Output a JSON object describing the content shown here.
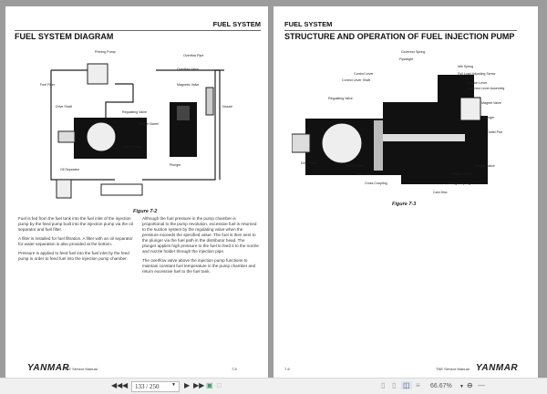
{
  "left_page": {
    "header": "FUEL SYSTEM",
    "title": "FUEL SYSTEM DIAGRAM",
    "labels": [
      "Priming Pump",
      "Overflow Pipe",
      "Overflow Valve",
      "Fuel Filter",
      "Magnetic Valve",
      "Drive Shaft",
      "Regulating Valve",
      "Nozzle",
      "Plunger Barrel",
      "Feed Pump",
      "Plunger",
      "Oil Separator"
    ],
    "figure": "Figure 7-2",
    "col1": [
      "Fuel is fed from the fuel tank into the fuel inlet of the injection pump by the feed pump built into the injection pump via the oil separator and fuel filter.",
      "A filter is installed for fuel filtration. A filter with an oil separator for water separation is also provided at the bottom.",
      "Pressure is applied to feed fuel into the fuel inlet by the feed pump in order to feed fuel into the injection pump chamber."
    ],
    "col2": [
      "Although the fuel pressure in the pump chamber is proportional to the pump revolution, excessive fuel is returned to the suction system by the regulating valve when the pressure exceeds the specified value. The fuel is then sent to the plunger via the fuel path in the distributor head. The plunger applies high pressure to the fuel to feed it to the nozzle and nozzle holder through the injection pipe.",
      "The overflow valve above the injection pump functions to maintain constant fuel temperature in the pump chamber and return excessive fuel to the fuel tank."
    ],
    "logo": "YANMAR",
    "manual": "TNE Service Manual",
    "page_no": "7-5"
  },
  "right_page": {
    "header": "FUEL SYSTEM",
    "title": "STRUCTURE AND OPERATION OF FUEL INJECTION PUMP",
    "labels": [
      "Governor Spring",
      "Flyweight",
      "Idle Spring",
      "Control Lever",
      "Full Load Adjusting Screw",
      "Control Lever Shaft",
      "Tension Lever",
      "Governor Lever Assembly",
      "Regulating Valve",
      "Magnet Valve",
      "Plunger",
      "Outlet Port",
      "Drive Shaft",
      "Feed Pump",
      "Delivery Valve",
      "Drive Gear",
      "Control Sleeve",
      "Cross Coupling",
      "Plunger Spring",
      "Cam Disc"
    ],
    "figure": "Figure 7-3",
    "logo": "YANMAR",
    "manual": "TNE Service Manual",
    "page_no": "7-6"
  },
  "toolbar": {
    "page_value": "133 / 250",
    "zoom": "66.67%"
  }
}
